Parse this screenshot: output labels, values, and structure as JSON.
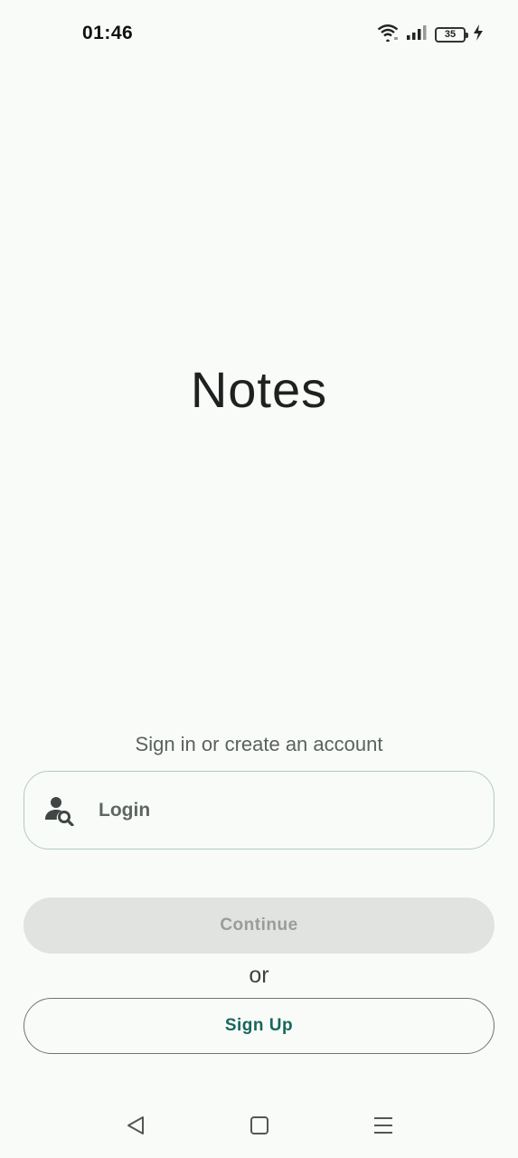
{
  "status_bar": {
    "time": "01:46",
    "battery_level": "35",
    "icons": [
      "wifi-icon",
      "signal-icon",
      "battery-icon",
      "charging-icon"
    ]
  },
  "app": {
    "title": "Notes"
  },
  "auth": {
    "subtitle": "Sign in or create an account",
    "login_label": "Login",
    "continue_label": "Continue",
    "or_text": "or",
    "signup_label": "Sign Up"
  },
  "nav_bar": {
    "icons": [
      "back-icon",
      "home-icon",
      "menu-icon"
    ]
  },
  "colors": {
    "background": "#f9fbf9",
    "accent": "#17665c",
    "disabled_button": "#e1e3e1"
  }
}
